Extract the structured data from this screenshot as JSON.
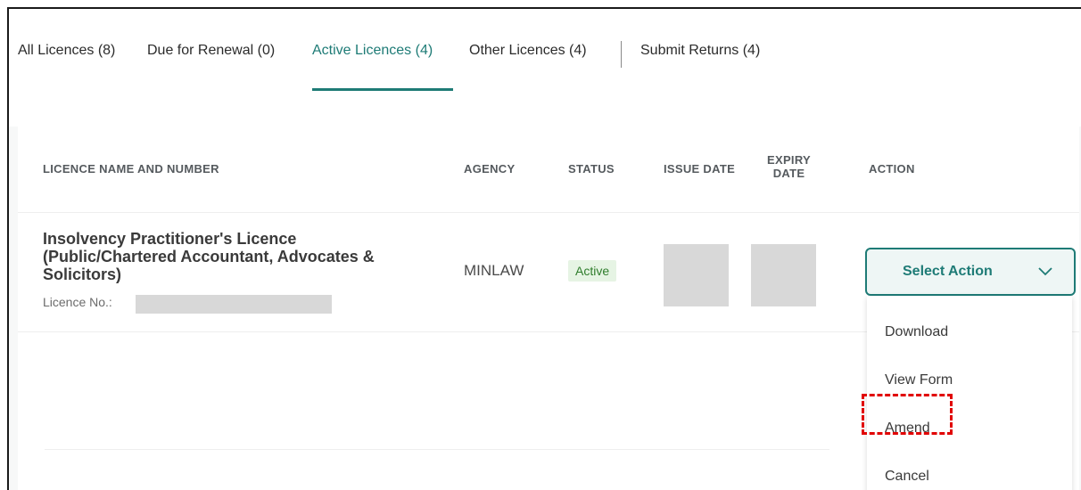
{
  "tabs": [
    {
      "label": "All Licences (8)"
    },
    {
      "label": "Due for Renewal (0)"
    },
    {
      "label": "Active Licences (4)"
    },
    {
      "label": "Other Licences (4)"
    },
    {
      "label": "Submit Returns (4)"
    }
  ],
  "active_tab": "Active Licences (4)",
  "table": {
    "headers": {
      "name": "LICENCE NAME AND NUMBER",
      "agency": "AGENCY",
      "status": "STATUS",
      "issue_date": "ISSUE DATE",
      "expiry_line1": "EXPIRY",
      "expiry_line2": "DATE",
      "action": "ACTION"
    },
    "rows": [
      {
        "name_line1": "Insolvency Practitioner's Licence",
        "name_line2": "(Public/Chartered Accountant, Advocates &",
        "name_line3": "Solicitors)",
        "licence_no_label": "Licence No.:",
        "agency": "MINLAW",
        "status": "Active",
        "action_label": "Select Action"
      }
    ]
  },
  "action_menu": {
    "items": [
      {
        "label": "Download"
      },
      {
        "label": "View Form"
      },
      {
        "label": "Amend"
      },
      {
        "label": "Cancel"
      }
    ]
  },
  "colors": {
    "accent": "#1e7b76",
    "status_bg": "#e6f4e4",
    "status_text": "#2f7d2c",
    "highlight": "#e10000"
  }
}
